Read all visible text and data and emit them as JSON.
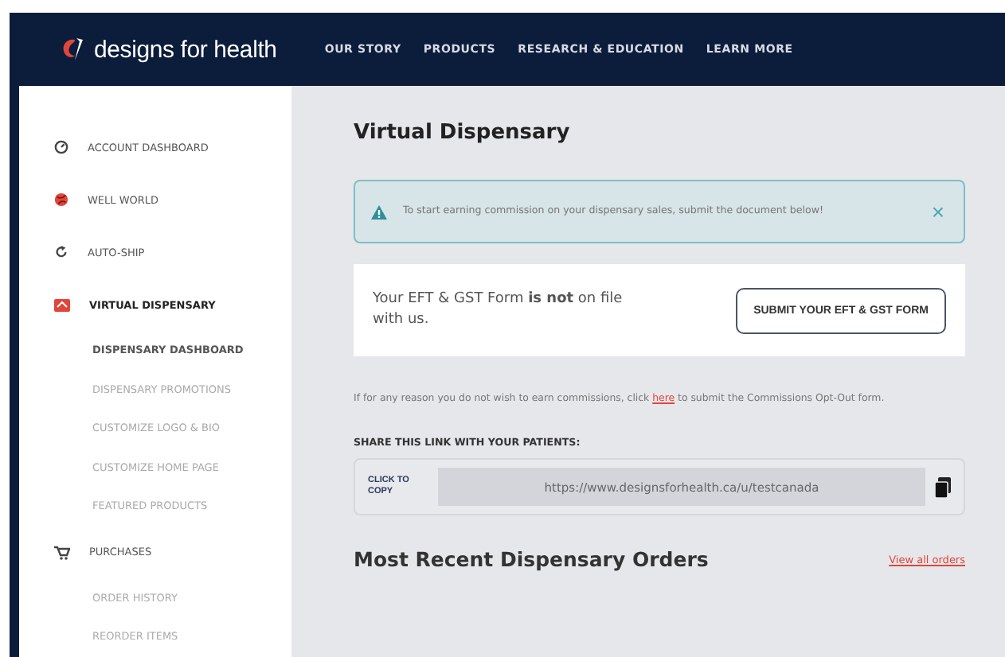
{
  "header": {
    "logo": "designs for health",
    "nav": [
      "OUR STORY",
      "PRODUCTS",
      "RESEARCH & EDUCATION",
      "LEARN MORE"
    ]
  },
  "sidebar": {
    "items": [
      {
        "label": "ACCOUNT DASHBOARD",
        "selected": false
      },
      {
        "label": "WELL WORLD",
        "selected": false
      },
      {
        "label": "AUTO-SHIP",
        "selected": false
      },
      {
        "label": "VIRTUAL DISPENSARY",
        "selected": true,
        "children": [
          {
            "label": "DISPENSARY DASHBOARD",
            "selected": true
          },
          {
            "label": "DISPENSARY PROMOTIONS",
            "selected": false
          },
          {
            "label": "CUSTOMIZE LOGO & BIO",
            "selected": false
          },
          {
            "label": "CUSTOMIZE HOME PAGE",
            "selected": false
          },
          {
            "label": "FEATURED PRODUCTS",
            "selected": false
          }
        ]
      },
      {
        "label": "PURCHASES",
        "selected": false,
        "children": [
          {
            "label": "ORDER HISTORY",
            "selected": false
          },
          {
            "label": "REORDER ITEMS",
            "selected": false
          }
        ]
      }
    ]
  },
  "main": {
    "title": "Virtual Dispensary",
    "alert": {
      "text": "To start earning commission on your dispensary sales, submit the document below!",
      "close": "×"
    },
    "form_card": {
      "text": "Your EFT & GST Form **is not** on file with us.",
      "button": "SUBMIT YOUR EFT & GST FORM"
    },
    "opt_out": {
      "before": "If for any reason you do not wish to earn commissions, click",
      "link": "here",
      "after": "to submit the Commissions Opt-Out form."
    },
    "share": {
      "label": "SHARE THIS LINK WITH YOUR PATIENTS:",
      "copy_label": "CLICK TO COPY",
      "url": "https://www.designsforhealth.ca/u/testcanada"
    },
    "orders": {
      "title": "Most Recent Dispensary Orders",
      "link": "View all orders"
    }
  }
}
